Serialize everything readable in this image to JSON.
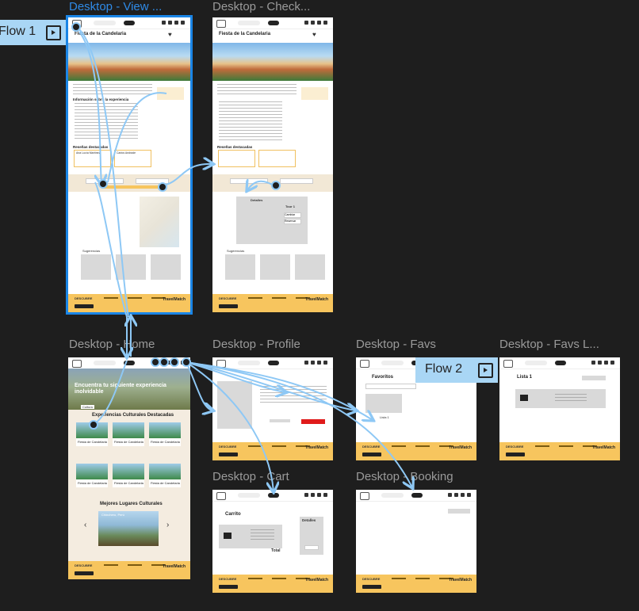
{
  "frames": {
    "view": {
      "label": "Desktop - View ...",
      "page_title": "Fiesta de la Candelaria",
      "info_title": "Información sobre la experiencia",
      "reviews_title": "Reseñas destacadas",
      "reviewer1": "Ana Lucía Martínez",
      "reviewer2": "Carlos Andrade",
      "suggestions": "Sugerencias",
      "footer_brand": "TravelMatch",
      "footer_descubre": "DESCUBRE"
    },
    "checkout": {
      "label": "Desktop - Check...",
      "page_title": "Fiesta de la Candelaria",
      "reviews_title": "Reseñas destacadas",
      "details": "Detalles",
      "tour": "Tour 1",
      "btn_cambiar": "Cambiar",
      "btn_reservar": "Reservar",
      "suggestions": "Sugerencias",
      "footer_brand": "TravelMatch",
      "footer_descubre": "DESCUBRE"
    },
    "home": {
      "label": "Desktop - Home",
      "hero_title": "Encuentra tu siguiente experiencia inolvidable",
      "chip": "Cultura",
      "featured_title": "Experiencias Culturales Destacadas",
      "card_title": "Fiesta de Candelaria",
      "places_title": "Mejores Lugares Culturales",
      "place_caption": "Chinchero, Perú",
      "prev": "‹",
      "next": "›",
      "footer_brand": "TravelMatch",
      "footer_descubre": "DESCUBRE"
    },
    "profile": {
      "label": "Desktop - Profile",
      "footer_brand": "TravelMatch",
      "footer_descubre": "DESCUBRE"
    },
    "favs": {
      "label": "Desktop - Favs",
      "title": "Favoritos",
      "list": "Lista 1",
      "footer_brand": "TravelMatch",
      "footer_descubre": "DESCUBRE"
    },
    "favs_list": {
      "label": "Desktop - Favs L...",
      "title": "Lista 1",
      "footer_brand": "TravelMatch",
      "footer_descubre": "DESCUBRE"
    },
    "cart": {
      "label": "Desktop - Cart",
      "title": "Carrito",
      "details": "Detalles",
      "total": "Total",
      "footer_brand": "TravelMatch",
      "footer_descubre": "DESCUBRE"
    },
    "booking": {
      "label": "Desktop - Booking",
      "footer_brand": "TravelMatch",
      "footer_descubre": "DESCUBRE"
    }
  },
  "flows": {
    "flow1": "Flow 1",
    "flow2": "Flow 2"
  },
  "colors": {
    "canvas": "#1e1e1e",
    "selection": "#1a85e6",
    "connector": "#8ec8f5",
    "footer": "#f7c55e",
    "cream": "#f2e8d6"
  }
}
